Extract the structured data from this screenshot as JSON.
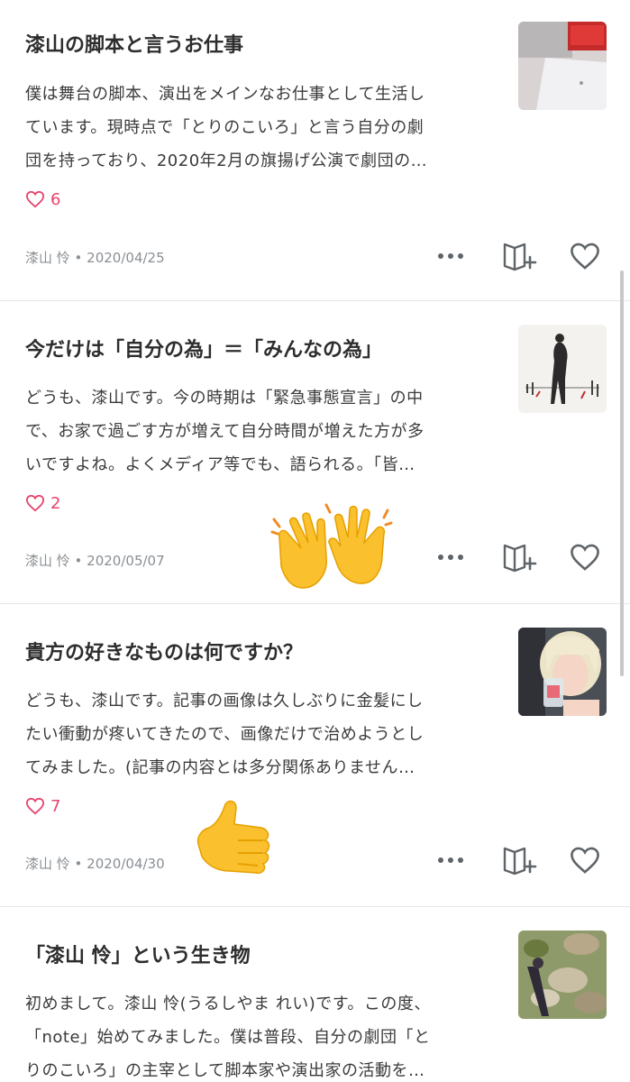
{
  "colors": {
    "like_accent": "#e8436c",
    "text_primary": "#2d2d2d",
    "text_muted": "#8a8f94",
    "divider": "#e6e6e6"
  },
  "posts": [
    {
      "title": "漆山の脚本と言うお仕事",
      "excerpt_lines": [
        "僕は舞台の脚本、演出をメインなお仕事として生活し",
        "ています。現時点で「とりのこいろ」と言う自分の劇",
        "団を持っており、2020年2月の旗揚げ公演で劇団の…"
      ],
      "likes": "6",
      "author": "漆山 怜",
      "date": "2020/04/25",
      "thumbnail_icon": "laptop-photo"
    },
    {
      "title": "今だけは「自分の為」＝「みんなの為」",
      "excerpt_lines": [
        "どうも、漆山です。今の時期は「緊急事態宣言」の中",
        "で、お家で過ごす方が増えて自分時間が増えた方が多",
        "いですよね。よくメディア等でも、語られる。「皆…"
      ],
      "likes": "2",
      "author": "漆山 怜",
      "date": "2020/05/07",
      "thumbnail_icon": "figure-sketch"
    },
    {
      "title": "貴方の好きなものは何ですか？",
      "excerpt_lines": [
        "どうも、漆山です。記事の画像は久しぶりに金髪にし",
        "たい衝動が疼いてきたので、画像だけで治めようとし",
        "てみました。(記事の内容とは多分関係ありません…"
      ],
      "likes": "7",
      "author": "漆山 怜",
      "date": "2020/04/30",
      "thumbnail_icon": "blonde-portrait"
    },
    {
      "title": "「漆山 怜」という生き物",
      "excerpt_lines": [
        "初めまして。漆山 怜(うるしやま れい)です。この度、",
        "「note」始めてみました。僕は普段、自分の劇団「と",
        "りのこいろ」の主宰として脚本家や演出家の活動を…"
      ],
      "thumbnail_icon": "nature-photo"
    }
  ],
  "emoji": {
    "first": "raising-hands-emoji",
    "second": "thumbs-up-emoji"
  }
}
